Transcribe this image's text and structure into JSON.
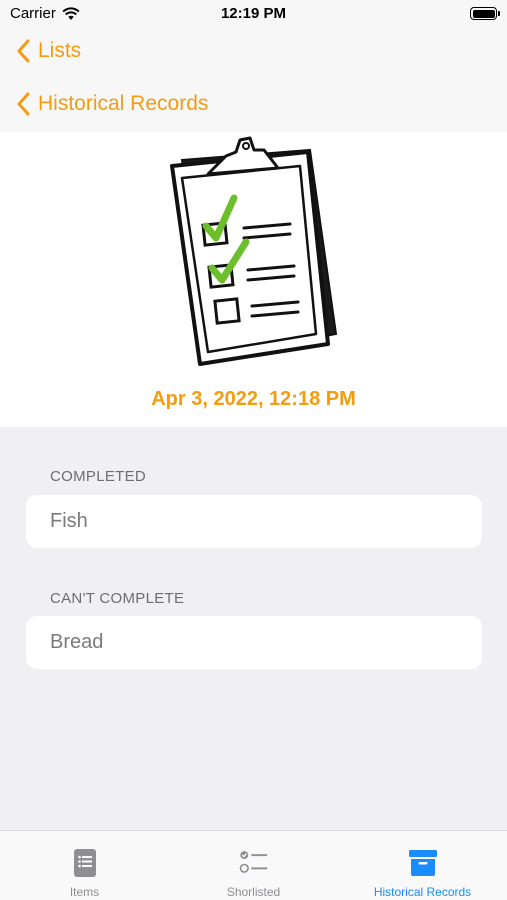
{
  "status_bar": {
    "carrier": "Carrier",
    "time": "12:19 PM"
  },
  "nav": {
    "back_lists": "Lists",
    "back_history": "Historical Records"
  },
  "record": {
    "date": "Apr 3, 2022, 12:18 PM"
  },
  "sections": [
    {
      "header": "COMPLETED",
      "items": [
        "Fish"
      ]
    },
    {
      "header": "CAN'T COMPLETE",
      "items": [
        "Bread"
      ]
    }
  ],
  "tabs": [
    {
      "label": "Items",
      "icon": "list-doc-icon",
      "selected": false
    },
    {
      "label": "Shorlisted",
      "icon": "checklist-icon",
      "selected": false
    },
    {
      "label": "Historical Records",
      "icon": "archive-box-icon",
      "selected": true
    }
  ],
  "colors": {
    "accent": "#f39c12",
    "tab_selected": "#1a8cff",
    "check_green": "#6cbf2a"
  }
}
